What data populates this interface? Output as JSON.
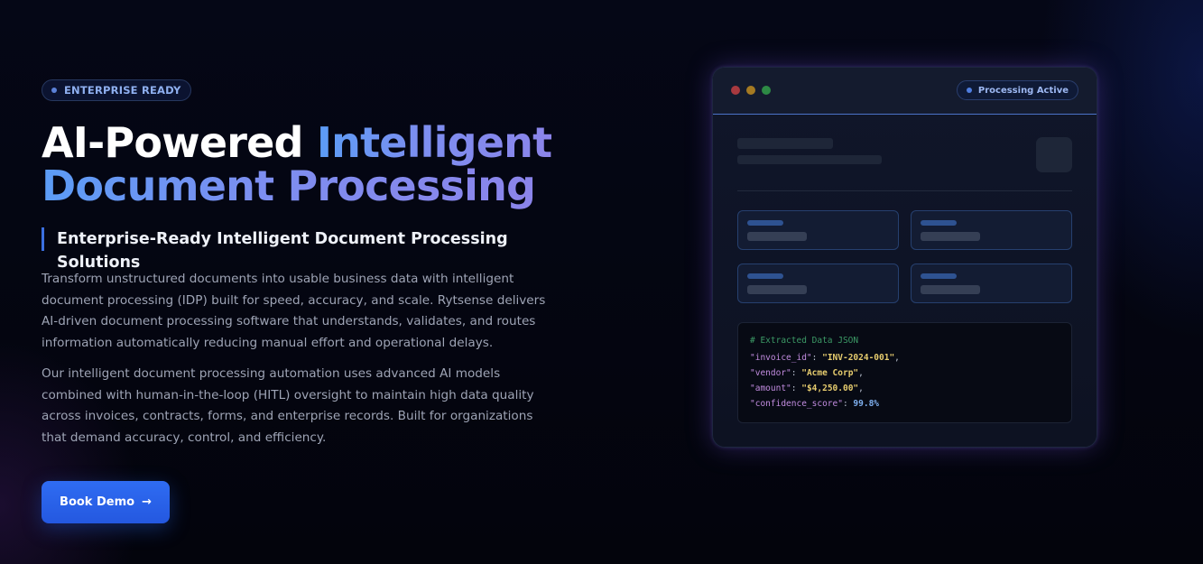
{
  "hero": {
    "badge": "ENTERPRISE READY",
    "headline_plain": "AI-Powered ",
    "headline_accent_1": "Intelligent",
    "headline_accent_2": "Document Processing",
    "subheading": "Enterprise-Ready Intelligent Document Processing Solutions",
    "paragraph_1": "Transform unstructured documents into usable business data with intelligent document processing (IDP) built for speed, accuracy, and scale. Rytsense delivers AI-driven document processing software that understands, validates, and routes information automatically reducing manual effort and operational delays.",
    "paragraph_2": "Our intelligent document processing automation uses advanced AI models combined with human-in-the-loop (HITL) oversight to maintain high data quality across invoices, contracts, forms, and enterprise records. Built for organizations that demand accuracy, control, and efficiency.",
    "cta_label": "Book Demo",
    "cta_arrow": "→"
  },
  "mockup": {
    "status": "Processing Active",
    "code_comment": "# Extracted Data JSON",
    "fields": [
      {
        "key": "\"invoice_id\"",
        "value": "\"INV-2024-001\"",
        "suffix": ","
      },
      {
        "key": "\"vendor\"",
        "value": "\"Acme Corp\"",
        "suffix": ","
      },
      {
        "key": "\"amount\"",
        "value": "\"$4,250.00\"",
        "suffix": ","
      },
      {
        "key": "\"confidence_score\"",
        "value": "99.8%",
        "suffix": ""
      }
    ]
  },
  "colors": {
    "background": "#03040d",
    "accent_blue": "#2f6cf2",
    "gradient_start": "#5b9cf6",
    "gradient_end": "#8b84ea",
    "window_glow": "#6e50d2"
  },
  "icons": {
    "badge": "status-dot-icon",
    "window_controls": [
      "close-dot-icon",
      "minimize-dot-icon",
      "maximize-dot-icon"
    ],
    "cta": "arrow-right-icon"
  }
}
